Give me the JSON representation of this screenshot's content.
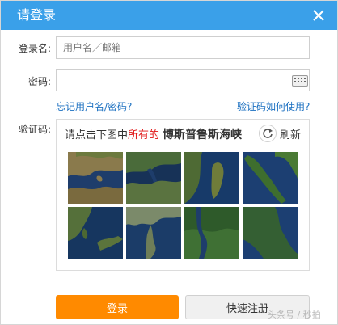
{
  "dialog": {
    "title": "请登录",
    "close_icon": "close-icon"
  },
  "form": {
    "username_label": "登录名:",
    "username_placeholder": "用户名／邮箱",
    "password_label": "密码:",
    "password_placeholder": "",
    "keyboard_icon": "keyboard-icon",
    "forgot_link": "忘记用户名/密码?",
    "captcha_help_link": "验证码如何使用?",
    "captcha_label": "验证码:"
  },
  "captcha": {
    "prompt_prefix": "请点击下图中",
    "prompt_highlight": "所有的",
    "prompt_target": "博斯普鲁斯海峡",
    "refresh_label": "刷新",
    "refresh_icon": "refresh-icon",
    "tiles": [
      {
        "id": "tile-1",
        "kind": "satellite-map"
      },
      {
        "id": "tile-2",
        "kind": "satellite-map"
      },
      {
        "id": "tile-3",
        "kind": "satellite-map"
      },
      {
        "id": "tile-4",
        "kind": "satellite-map"
      },
      {
        "id": "tile-5",
        "kind": "satellite-map"
      },
      {
        "id": "tile-6",
        "kind": "satellite-map"
      },
      {
        "id": "tile-7",
        "kind": "satellite-map"
      },
      {
        "id": "tile-8",
        "kind": "satellite-map"
      }
    ]
  },
  "actions": {
    "login_label": "登录",
    "register_label": "快速注册"
  },
  "colors": {
    "titlebar": "#3aa0e9",
    "link": "#1a6fc0",
    "login_button": "#ff8a00",
    "highlight": "#e01010"
  },
  "watermark": "头条号 / 秒拍"
}
